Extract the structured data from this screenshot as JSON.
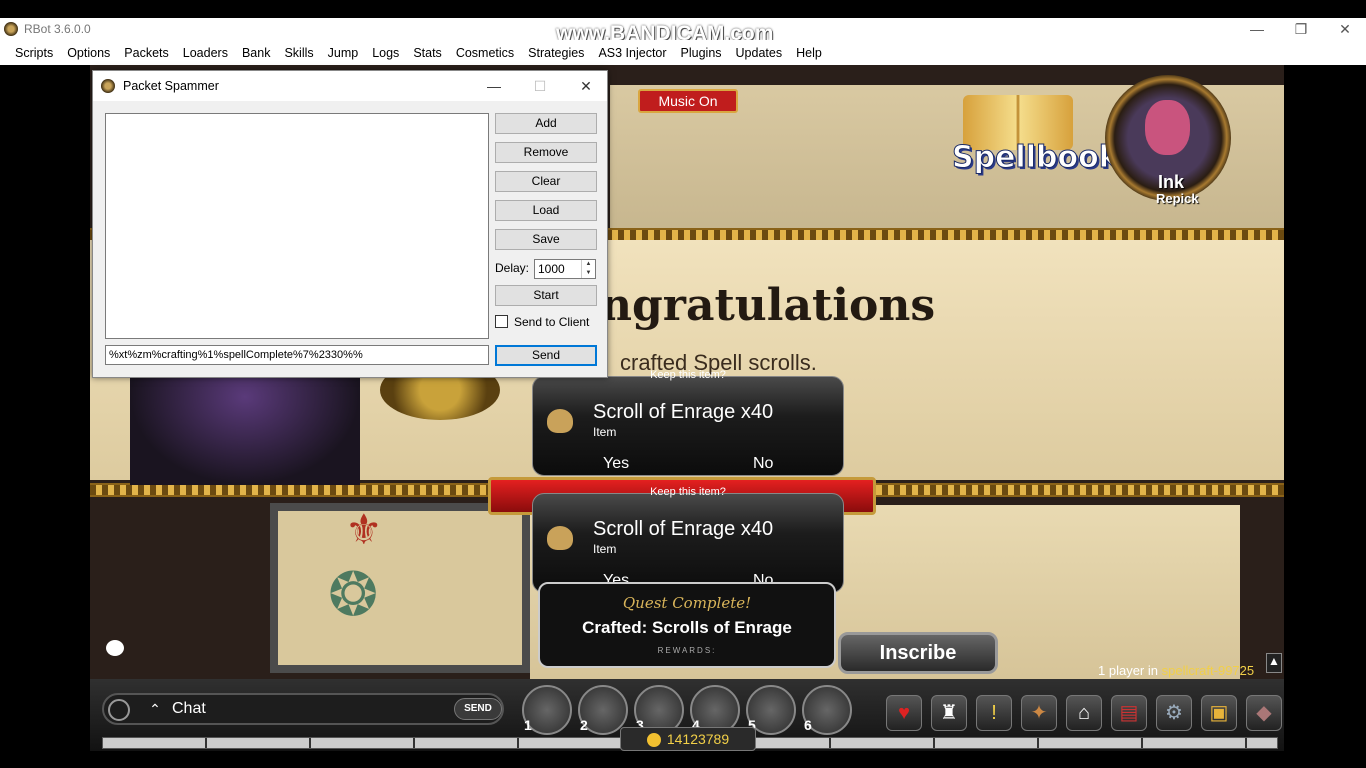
{
  "window": {
    "title": "RBot 3.6.0.0",
    "watermark": "www.BANDICAM.com",
    "minimize": "—",
    "maximize": "❐",
    "close": "✕"
  },
  "menu": [
    "Scripts",
    "Options",
    "Packets",
    "Loaders",
    "Bank",
    "Skills",
    "Jump",
    "Logs",
    "Stats",
    "Cosmetics",
    "Strategies",
    "AS3 Injector",
    "Plugins",
    "Updates",
    "Help"
  ],
  "spammer": {
    "title": "Packet Spammer",
    "minimize": "—",
    "maximize": "☐",
    "close": "✕",
    "buttons": {
      "add": "Add",
      "remove": "Remove",
      "clear": "Clear",
      "load": "Load",
      "save": "Save",
      "start": "Start",
      "send": "Send"
    },
    "delay_label": "Delay:",
    "delay_value": "1000",
    "send_to_client": "Send to Client",
    "packet_value": "%xt%zm%crafting%1%spellComplete%7%2330%%"
  },
  "game": {
    "music_button": "Music On",
    "spellbook": "Spellbook",
    "portrait_name": "Ink",
    "portrait_sub": "Repick",
    "congrats": "ngratulations",
    "crafted_text": "crafted Spell scrolls.",
    "dialogs": [
      {
        "prompt": "Keep this item?",
        "item": "Scroll of Enrage x40",
        "type": "Item",
        "yes": "Yes",
        "no": "No"
      },
      {
        "prompt": "Keep this item?",
        "item": "Scroll of Enrage x40",
        "type": "Item",
        "yes": "Yes",
        "no": "No"
      }
    ],
    "quest": {
      "heading": "Quest Complete!",
      "title": "Crafted: Scrolls of Enrage",
      "rewards": "REWARDS:"
    },
    "inscribe": "Inscribe",
    "players_prefix": "1 player in",
    "server": "spellcraft-99725",
    "chat_label": "Chat",
    "chat_send": "SEND",
    "skills": [
      "1",
      "2",
      "3",
      "4",
      "5",
      "6"
    ],
    "gold": "14123789"
  }
}
